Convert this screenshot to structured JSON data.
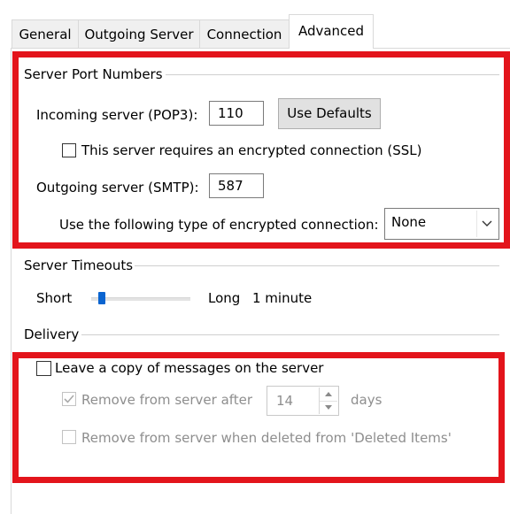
{
  "tabs": [
    {
      "label": "General"
    },
    {
      "label": "Outgoing Server"
    },
    {
      "label": "Connection"
    },
    {
      "label": "Advanced"
    }
  ],
  "port_numbers": {
    "group_label": "Server Port Numbers",
    "incoming_label": "Incoming server (POP3):",
    "incoming_value": "110",
    "use_defaults_label": "Use Defaults",
    "ssl_label": "This server requires an encrypted connection (SSL)",
    "outgoing_label": "Outgoing server (SMTP):",
    "outgoing_value": "587",
    "encryption_label": "Use the following type of encrypted connection:",
    "encryption_value": "None"
  },
  "timeouts": {
    "group_label": "Server Timeouts",
    "short_label": "Short",
    "long_label": "Long",
    "value_label": "1 minute"
  },
  "delivery": {
    "group_label": "Delivery",
    "leave_copy_label": "Leave a copy of messages on the server",
    "remove_after_label": "Remove from server after",
    "remove_after_days": "14",
    "days_label": "days",
    "remove_deleted_label": "Remove from server when deleted from 'Deleted Items'"
  },
  "colors": {
    "highlight": "#e3141b",
    "slider_thumb": "#0a64d0"
  }
}
